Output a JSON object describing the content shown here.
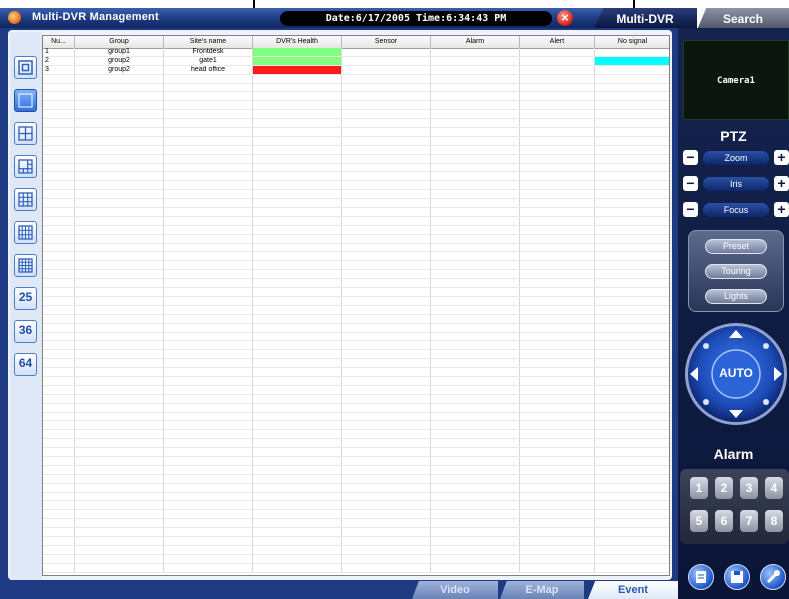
{
  "app": {
    "title": "Multi-DVR Management",
    "datetime": "Date:6/17/2005 Time:6:34:43 PM",
    "close_glyph": "×"
  },
  "top_tabs": [
    {
      "label": "Multi-DVR",
      "active": true
    },
    {
      "label": "Search",
      "active": false
    }
  ],
  "table": {
    "columns": [
      "Nu...",
      "Group",
      "Site's name",
      "DVR's Health",
      "Sensor",
      "Alarm",
      "Alert",
      "No signal"
    ],
    "rows": [
      {
        "num": "1",
        "group": "group1",
        "site": "Frontdesk",
        "health_color": "#80ff80",
        "no_signal_color": ""
      },
      {
        "num": "2",
        "group": "group2",
        "site": "gate1",
        "health_color": "#80ff80",
        "no_signal_color": "#00ffff"
      },
      {
        "num": "3",
        "group": "group2",
        "site": "head office",
        "health_color": "#ff1a1a",
        "no_signal_color": ""
      }
    ]
  },
  "left_toolbar": {
    "buttons": [
      {
        "name": "fullscreen-view-icon"
      },
      {
        "name": "single-view-icon",
        "selected": true
      },
      {
        "name": "quad-view-icon"
      },
      {
        "name": "split-6-view-icon"
      },
      {
        "name": "split-9-view-icon"
      },
      {
        "name": "split-10-view-icon"
      },
      {
        "name": "split-16-view-icon"
      },
      {
        "name": "split-25-view-button",
        "label": "25"
      },
      {
        "name": "split-36-view-button",
        "label": "36"
      },
      {
        "name": "split-64-view-button",
        "label": "64"
      }
    ]
  },
  "bottom_tabs": [
    {
      "label": "Video",
      "active": false
    },
    {
      "label": "E-Map",
      "active": false
    },
    {
      "label": "Event",
      "active": true
    }
  ],
  "right_panel": {
    "camera_label": "Camera1",
    "ptz_title": "PTZ",
    "controls": [
      {
        "label": "Zoom",
        "minus": "−",
        "plus": "+"
      },
      {
        "label": "Iris",
        "minus": "−",
        "plus": "+"
      },
      {
        "label": "Focus",
        "minus": "−",
        "plus": "+"
      }
    ],
    "presets": [
      "Preset",
      "Touring",
      "Lights"
    ],
    "joystick_label": "AUTO",
    "alarm_title": "Alarm",
    "alarm_buttons": [
      "1",
      "2",
      "3",
      "4",
      "5",
      "6",
      "7",
      "8"
    ],
    "bottom_icons": [
      "schedule-icon",
      "save-icon",
      "tools-icon"
    ]
  }
}
